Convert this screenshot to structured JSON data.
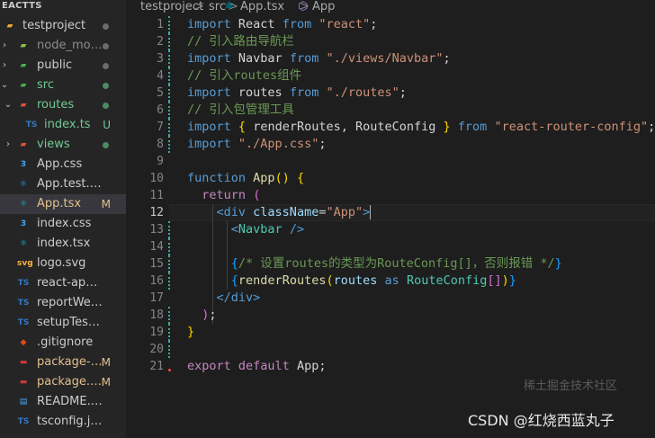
{
  "sidebar": {
    "header": "EACTTS",
    "items": [
      {
        "label": "testproject",
        "icon": "folder-icon",
        "icon_color": "#e8a838",
        "chevron": "",
        "status": "dot"
      },
      {
        "label": "node_modules",
        "icon": "node-folder-icon",
        "icon_color": "#8bc34a",
        "chevron": "›",
        "status": "dot",
        "dim": true
      },
      {
        "label": "public",
        "icon": "public-folder-icon",
        "icon_color": "#4caf50",
        "chevron": "›",
        "status": "dot"
      },
      {
        "label": "src",
        "icon": "src-folder-icon",
        "icon_color": "#4caf50",
        "chevron": "⌄",
        "status": "dot",
        "color": "#73c991"
      },
      {
        "label": "routes",
        "icon": "routes-folder-icon",
        "icon_color": "#e0533b",
        "chevron": "⌄",
        "status": "dot",
        "color": "#73c991"
      },
      {
        "label": "index.ts",
        "icon": "typescript-icon",
        "icon_color": "#3178c6",
        "chevron": "",
        "status": "U",
        "color": "#73c991"
      },
      {
        "label": "views",
        "icon": "views-folder-icon",
        "icon_color": "#e0533b",
        "chevron": "›",
        "status": "dot",
        "color": "#73c991"
      },
      {
        "label": "App.css",
        "icon": "css-icon",
        "icon_color": "#42a5f5",
        "chevron": "",
        "status": ""
      },
      {
        "label": "App.test.tsx",
        "icon": "test-tsx-icon",
        "icon_color": "#1ea1f1",
        "chevron": "",
        "status": ""
      },
      {
        "label": "App.tsx",
        "icon": "react-icon",
        "icon_color": "#00bcd4",
        "chevron": "",
        "status": "M",
        "color": "#e2c08d",
        "selected": true
      },
      {
        "label": "index.css",
        "icon": "css-icon",
        "icon_color": "#42a5f5",
        "chevron": "",
        "status": ""
      },
      {
        "label": "index.tsx",
        "icon": "react-icon",
        "icon_color": "#00bcd4",
        "chevron": "",
        "status": ""
      },
      {
        "label": "logo.svg",
        "icon": "svg-icon",
        "icon_color": "#ffb13b",
        "chevron": "",
        "status": ""
      },
      {
        "label": "react-app-env....",
        "icon": "typescript-icon",
        "icon_color": "#3178c6",
        "chevron": "",
        "status": ""
      },
      {
        "label": "reportWebVital...",
        "icon": "typescript-icon",
        "icon_color": "#3178c6",
        "chevron": "",
        "status": ""
      },
      {
        "label": "setupTests.ts",
        "icon": "typescript-icon",
        "icon_color": "#3178c6",
        "chevron": "",
        "status": ""
      },
      {
        "label": ".gitignore",
        "icon": "git-icon",
        "icon_color": "#e64a19",
        "chevron": "",
        "status": ""
      },
      {
        "label": "package-l...",
        "icon": "npm-icon",
        "icon_color": "#cb3837",
        "chevron": "",
        "status": "M",
        "color": "#e2c08d"
      },
      {
        "label": "package.js...",
        "icon": "npm-icon",
        "icon_color": "#cb3837",
        "chevron": "",
        "status": "M",
        "color": "#e2c08d"
      },
      {
        "label": "README.md",
        "icon": "markdown-icon",
        "icon_color": "#42a5f5",
        "chevron": "",
        "status": ""
      },
      {
        "label": "tsconfig.json",
        "icon": "tsconfig-icon",
        "icon_color": "#3178c6",
        "chevron": "",
        "status": ""
      }
    ]
  },
  "breadcrumb": {
    "parts": [
      "testproject",
      "src",
      "App.tsx",
      "App"
    ],
    "separator": ">"
  },
  "editor": {
    "active_line": 12,
    "lines": [
      {
        "n": "1",
        "t": [
          [
            "kw",
            "import"
          ],
          [
            "",
            " React "
          ],
          [
            "kw",
            "from"
          ],
          [
            "",
            " "
          ],
          [
            "str",
            "\"react\""
          ],
          [
            "",
            ";"
          ]
        ]
      },
      {
        "n": "2",
        "t": [
          [
            "cmt",
            "// 引入路由导航栏"
          ]
        ]
      },
      {
        "n": "3",
        "t": [
          [
            "kw",
            "import"
          ],
          [
            "",
            " Navbar "
          ],
          [
            "kw",
            "from"
          ],
          [
            "",
            " "
          ],
          [
            "str",
            "\"./views/Navbar\""
          ],
          [
            "",
            ";"
          ]
        ]
      },
      {
        "n": "4",
        "t": [
          [
            "cmt",
            "// 引入routes组件"
          ]
        ]
      },
      {
        "n": "5",
        "t": [
          [
            "kw",
            "import"
          ],
          [
            "",
            " routes "
          ],
          [
            "kw",
            "from"
          ],
          [
            "",
            " "
          ],
          [
            "str",
            "\"./routes\""
          ],
          [
            "",
            ";"
          ]
        ]
      },
      {
        "n": "6",
        "t": [
          [
            "cmt",
            "// 引入包管理工具"
          ]
        ]
      },
      {
        "n": "7",
        "t": [
          [
            "kw",
            "import"
          ],
          [
            "",
            " "
          ],
          [
            "br1",
            "{"
          ],
          [
            "",
            " renderRoutes, RouteConfig "
          ],
          [
            "br1",
            "}"
          ],
          [
            "",
            " "
          ],
          [
            "kw",
            "from"
          ],
          [
            "",
            " "
          ],
          [
            "str",
            "\"react-router-config\""
          ],
          [
            "",
            ";"
          ]
        ]
      },
      {
        "n": "8",
        "t": [
          [
            "kw",
            "import"
          ],
          [
            "",
            " "
          ],
          [
            "str",
            "\"./App.css\""
          ],
          [
            "",
            ";"
          ]
        ]
      },
      {
        "n": "9",
        "t": []
      },
      {
        "n": "10",
        "t": [
          [
            "kw",
            "function"
          ],
          [
            "",
            " "
          ],
          [
            "fn",
            "App"
          ],
          [
            "br1",
            "()"
          ],
          [
            "",
            " "
          ],
          [
            "br1",
            "{"
          ]
        ]
      },
      {
        "n": "11",
        "t": [
          [
            "",
            "  "
          ],
          [
            "ctl",
            "return"
          ],
          [
            "",
            " "
          ],
          [
            "br2",
            "("
          ]
        ]
      },
      {
        "n": "12",
        "t": [
          [
            "",
            "    "
          ],
          [
            "tag",
            "<div"
          ],
          [
            "",
            " "
          ],
          [
            "attr",
            "className"
          ],
          [
            "",
            "="
          ],
          [
            "str",
            "\"App\""
          ],
          [
            "tag",
            ">"
          ]
        ]
      },
      {
        "n": "13",
        "t": [
          [
            "",
            "      "
          ],
          [
            "tag",
            "<"
          ],
          [
            "ty",
            "Navbar"
          ],
          [
            "",
            " "
          ],
          [
            "tag",
            "/>"
          ]
        ]
      },
      {
        "n": "14",
        "t": []
      },
      {
        "n": "15",
        "t": [
          [
            "",
            "      "
          ],
          [
            "br3",
            "{"
          ],
          [
            "cmt",
            "/* 设置routes的类型为RouteConfig[]，否则报错 */"
          ],
          [
            "br3",
            "}"
          ]
        ]
      },
      {
        "n": "16",
        "t": [
          [
            "",
            "      "
          ],
          [
            "br3",
            "{"
          ],
          [
            "fn",
            "renderRoutes"
          ],
          [
            "br1",
            "("
          ],
          [
            "vr",
            "routes"
          ],
          [
            "",
            " "
          ],
          [
            "kw",
            "as"
          ],
          [
            "",
            " "
          ],
          [
            "ty",
            "RouteConfig"
          ],
          [
            "br2",
            "[]"
          ],
          [
            "br1",
            ")"
          ],
          [
            "br3",
            "}"
          ]
        ]
      },
      {
        "n": "17",
        "t": [
          [
            "",
            "    "
          ],
          [
            "tag",
            "</div>"
          ]
        ]
      },
      {
        "n": "18",
        "t": [
          [
            "",
            "  "
          ],
          [
            "br2",
            ")"
          ],
          [
            "",
            ";"
          ]
        ]
      },
      {
        "n": "19",
        "t": [
          [
            "br1",
            "}"
          ]
        ]
      },
      {
        "n": "20",
        "t": []
      },
      {
        "n": "21",
        "t": [
          [
            "ctl",
            "export"
          ],
          [
            "",
            " "
          ],
          [
            "ctl",
            "default"
          ],
          [
            "",
            " App;"
          ]
        ]
      }
    ]
  },
  "watermark": {
    "text": "CSDN @红烧西蓝丸子",
    "faint_text": "稀土掘金技术社区"
  }
}
